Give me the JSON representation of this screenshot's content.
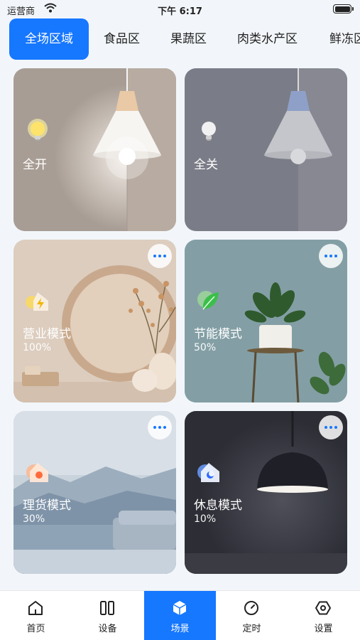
{
  "status_bar": {
    "carrier": "运营商",
    "time": "下午 6:17"
  },
  "tabs": [
    "全场区域",
    "食品区",
    "果蔬区",
    "肉类水产区",
    "鲜冻区"
  ],
  "active_tab": 0,
  "cards": [
    {
      "label": "全开",
      "percent": ""
    },
    {
      "label": "全关",
      "percent": ""
    },
    {
      "label": "营业模式",
      "percent": "100%"
    },
    {
      "label": "节能模式",
      "percent": "50%"
    },
    {
      "label": "理货模式",
      "percent": "30%"
    },
    {
      "label": "休息模式",
      "percent": "10%"
    }
  ],
  "bottom_nav": [
    {
      "label": "首页",
      "icon": "home-icon"
    },
    {
      "label": "设备",
      "icon": "device-icon"
    },
    {
      "label": "场景",
      "icon": "scene-cube-icon"
    },
    {
      "label": "定时",
      "icon": "timer-icon"
    },
    {
      "label": "设置",
      "icon": "settings-icon"
    }
  ],
  "colors": {
    "accent": "#1677ff"
  }
}
